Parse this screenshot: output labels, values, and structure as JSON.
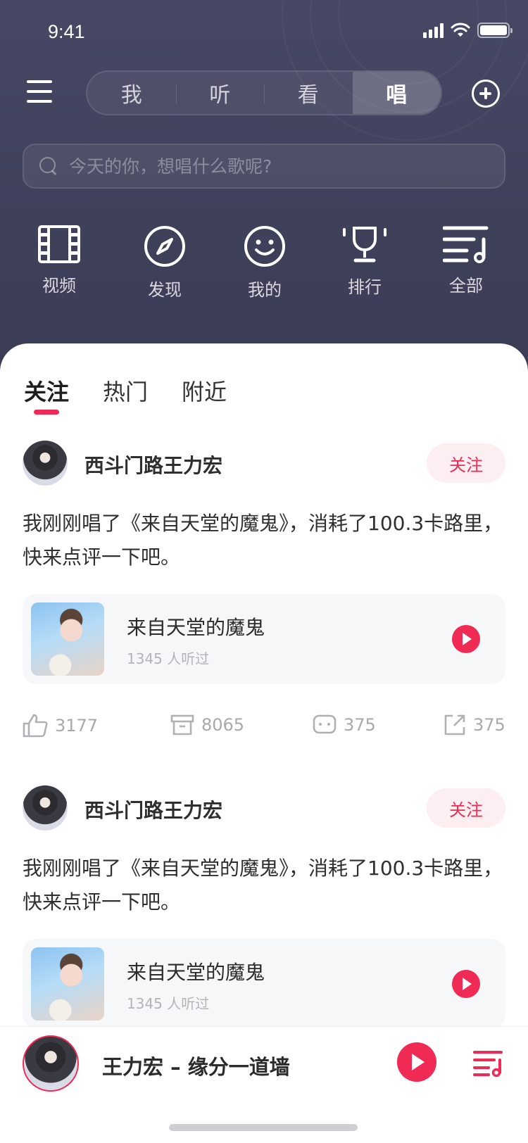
{
  "status_bar": {
    "time": "9:41"
  },
  "top_nav": {
    "segments": [
      {
        "label": "我",
        "active": false
      },
      {
        "label": "听",
        "active": false
      },
      {
        "label": "看",
        "active": false
      },
      {
        "label": "唱",
        "active": true
      }
    ]
  },
  "search": {
    "placeholder": "今天的你，想唱什么歌呢?",
    "value": ""
  },
  "categories": [
    {
      "label": "视频",
      "icon": "film-icon"
    },
    {
      "label": "发现",
      "icon": "compass-icon"
    },
    {
      "label": "我的",
      "icon": "smiley-icon"
    },
    {
      "label": "排行",
      "icon": "trophy-icon"
    },
    {
      "label": "全部",
      "icon": "playlist-icon"
    }
  ],
  "feed_tabs": [
    {
      "label": "关注",
      "active": true
    },
    {
      "label": "热门",
      "active": false
    },
    {
      "label": "附近",
      "active": false
    }
  ],
  "posts": [
    {
      "username": "西斗门路王力宏",
      "follow_label": "关注",
      "content": "我刚刚唱了《来自天堂的魔鬼》，消耗了100.3卡路里，快来点评一下吧。",
      "song": {
        "title": "来自天堂的魔鬼",
        "meta": "1345 人听过"
      },
      "stats": {
        "likes": "3177",
        "saves": "8065",
        "comments": "375",
        "shares": "375"
      }
    },
    {
      "username": "西斗门路王力宏",
      "follow_label": "关注",
      "content": "我刚刚唱了《来自天堂的魔鬼》，消耗了100.3卡路里，快来点评一下吧。",
      "song": {
        "title": "来自天堂的魔鬼",
        "meta": "1345 人听过"
      }
    }
  ],
  "player": {
    "now_playing": "王力宏 – 缘分一道墙"
  },
  "colors": {
    "accent": "#ee2a55",
    "header_bg": "#434460",
    "card_bg": "#f6f7f9"
  }
}
